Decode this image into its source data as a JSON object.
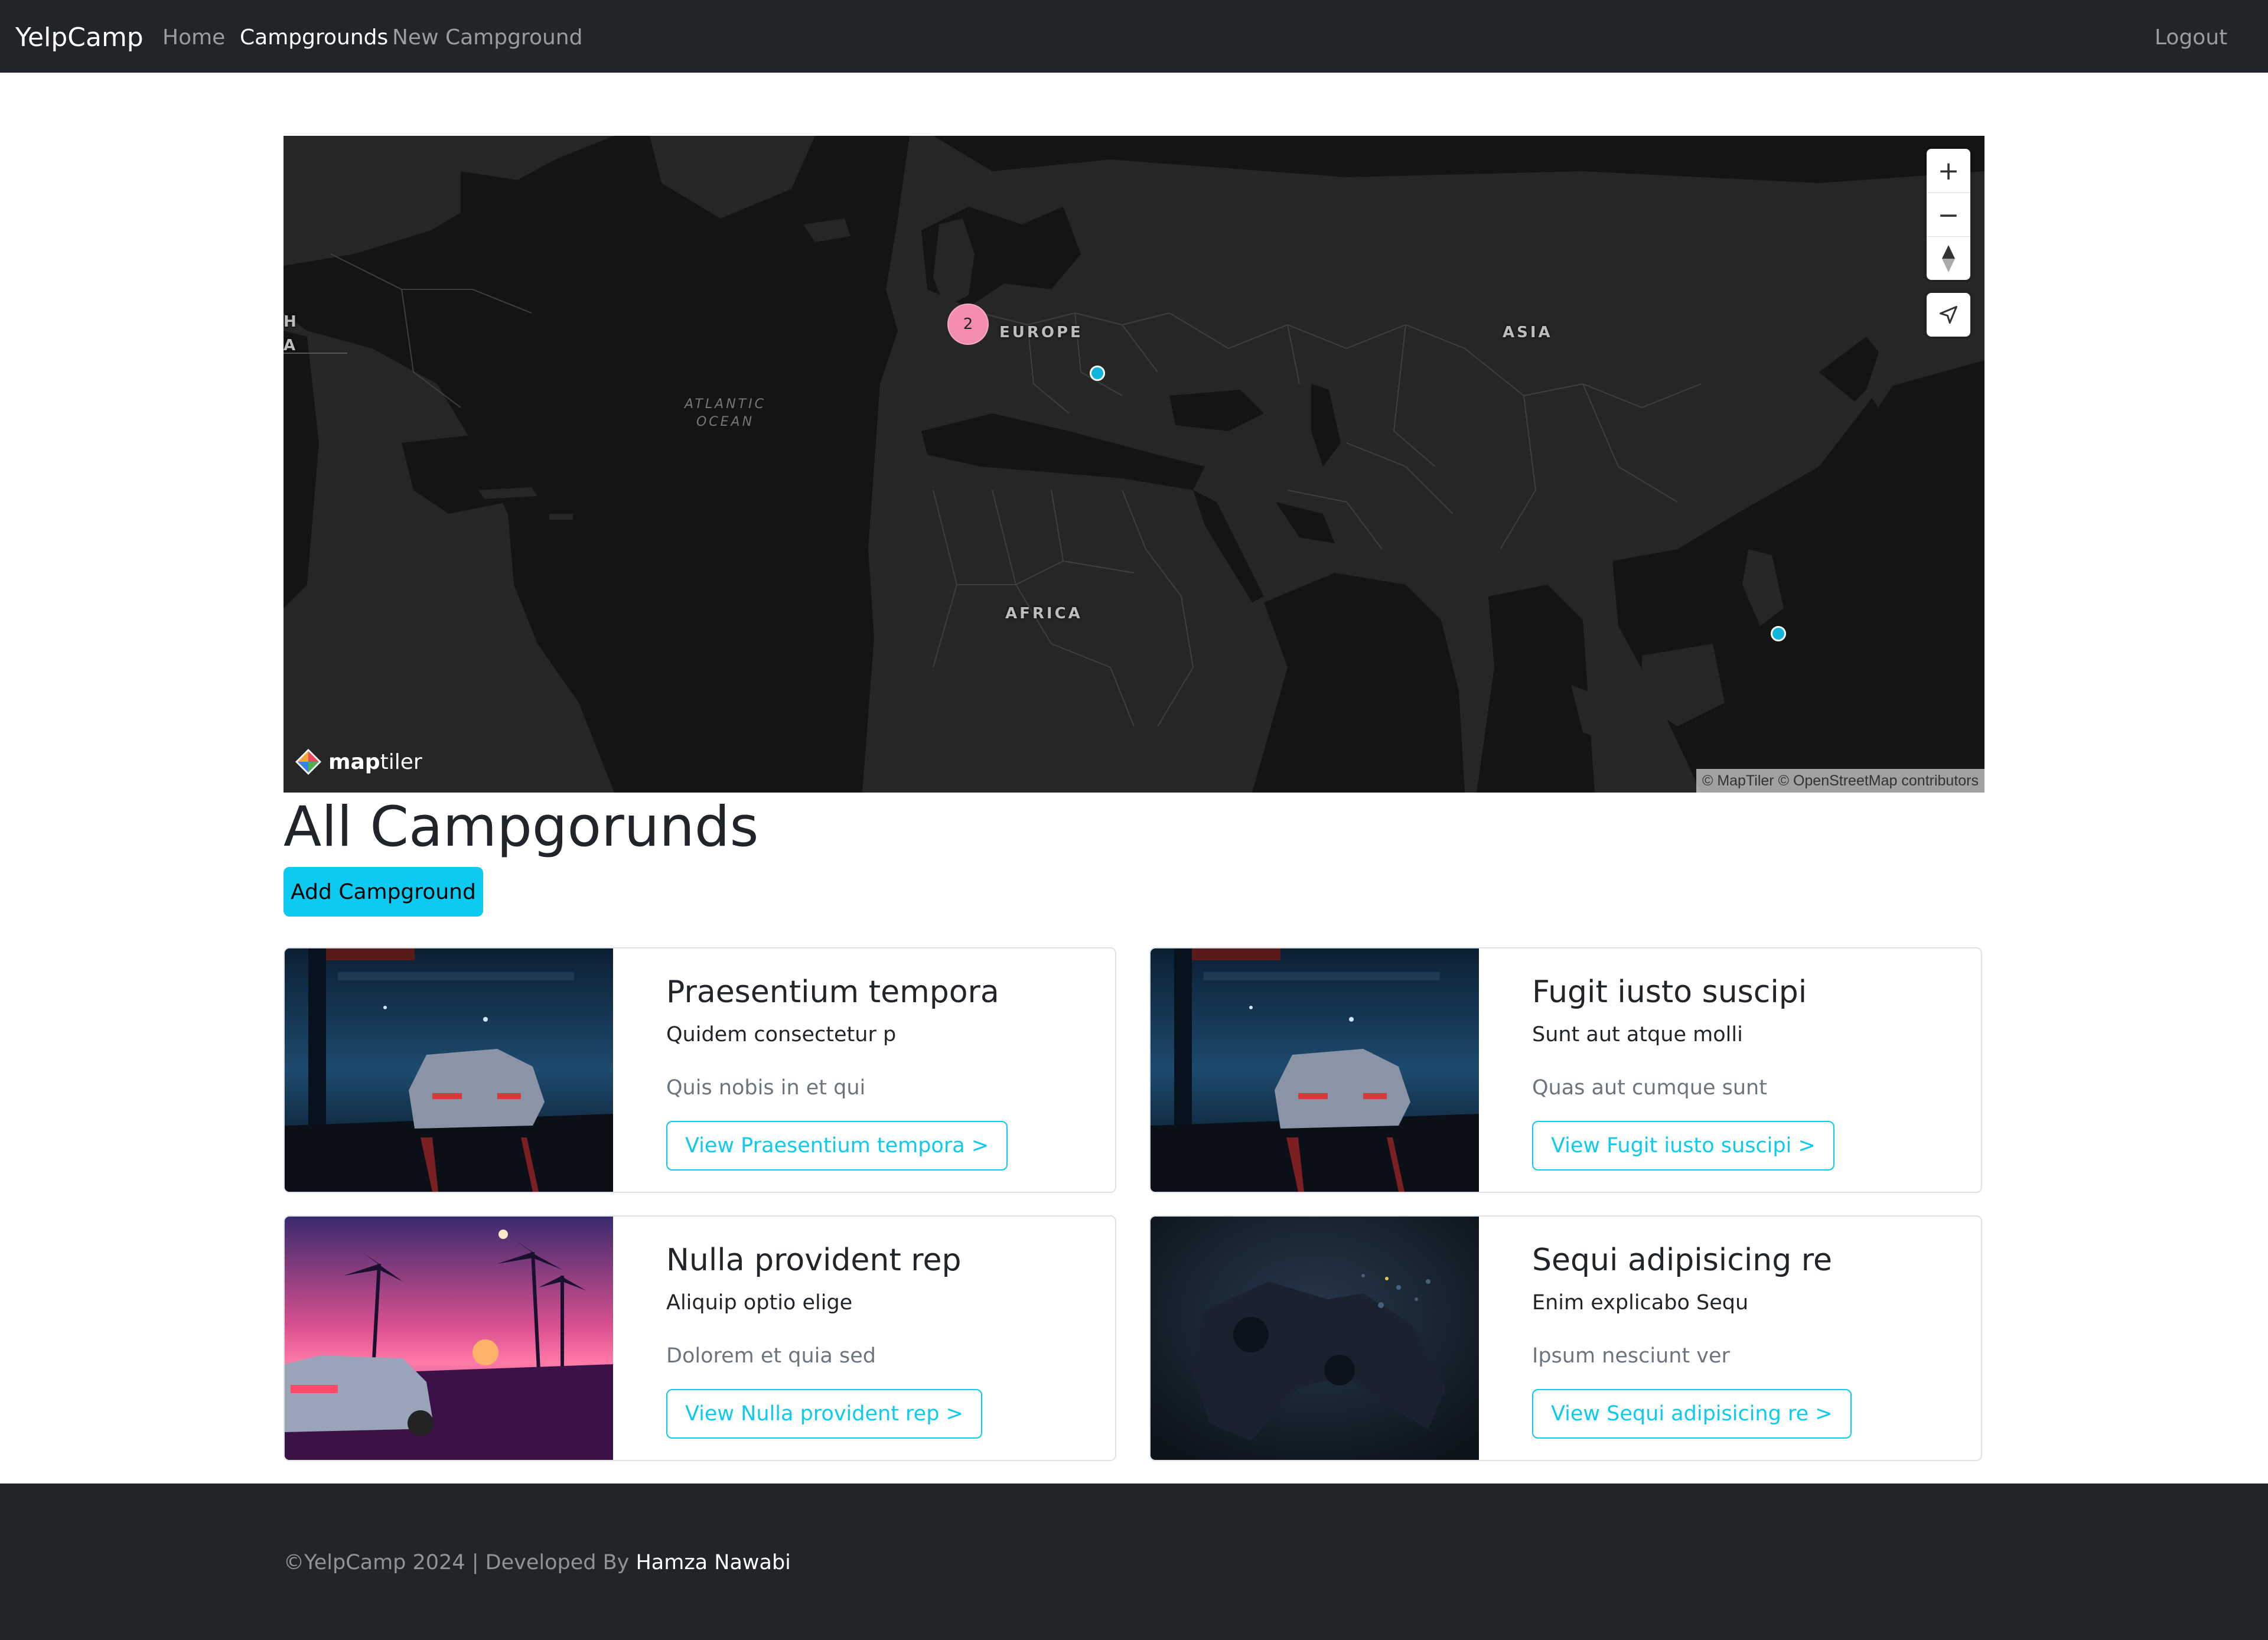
{
  "navbar": {
    "brand": "YelpCamp",
    "links": [
      {
        "label": "Home",
        "active": false
      },
      {
        "label": "Campgrounds",
        "active": true
      },
      {
        "label": "New Campground",
        "active": false
      }
    ],
    "logout": "Logout"
  },
  "map": {
    "labels": {
      "europe": "EUROPE",
      "asia": "ASIA",
      "africa": "AFRICA",
      "ocean_line1": "ATLANTIC",
      "ocean_line2": "OCEAN",
      "edge_top": "H",
      "edge_bottom": "A"
    },
    "cluster_count": "2",
    "controls": {
      "zoom_in": "+",
      "zoom_out": "−"
    },
    "logo": {
      "bold": "map",
      "thin": "tiler"
    },
    "attribution": "© MapTiler © OpenStreetMap contributors",
    "colors": {
      "land": "#262626",
      "sea": "#141414",
      "cluster": "#f28cb1",
      "pin": "#11b4da"
    }
  },
  "page": {
    "title": "All Campgorunds",
    "add_button": "Add Campground"
  },
  "campgrounds": [
    {
      "title": "Praesentium tempora",
      "description": "Quidem consectetur p",
      "location": "Quis nobis in et qui",
      "button": "View Praesentium tempora >",
      "image": "car-neon-garage"
    },
    {
      "title": "Fugit iusto suscipi",
      "description": "Sunt aut atque molli",
      "location": "Quas aut cumque sunt",
      "button": "View Fugit iusto suscipi >",
      "image": "car-neon-garage"
    },
    {
      "title": "Nulla provident rep",
      "description": "Aliquip optio elige",
      "location": "Dolorem et quia sed",
      "button": "View Nulla provident rep >",
      "image": "delorean-palm-sunset"
    },
    {
      "title": "Sequi adipisicing re",
      "description": "Enim explicabo Sequ",
      "location": "Ipsum nesciunt ver",
      "button": "View Sequi adipisicing re >",
      "image": "gamepad-dark"
    }
  ],
  "footer": {
    "text": "©YelpCamp 2024 | Developed By ",
    "author": "Hamza Nawabi"
  },
  "colors": {
    "accent": "#0dcaf0",
    "dark": "#212529"
  }
}
